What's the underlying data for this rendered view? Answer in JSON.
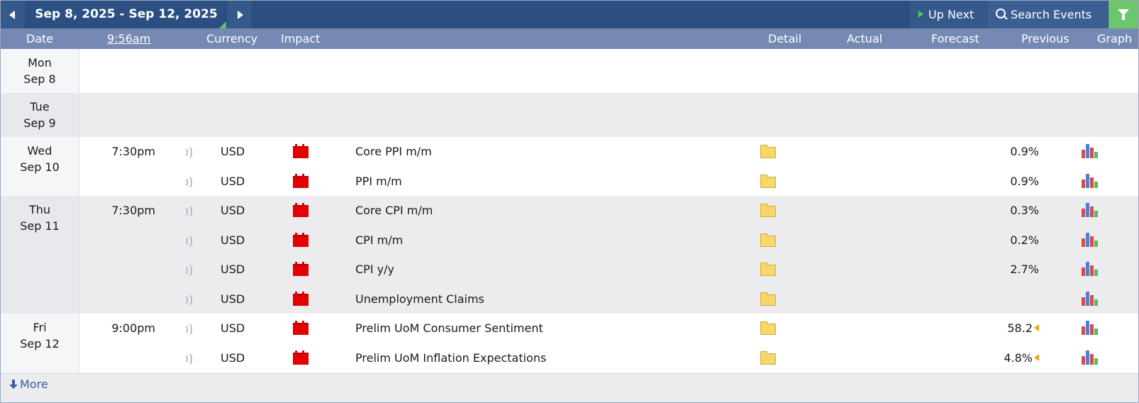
{
  "toolbar": {
    "date_range": "Sep 8, 2025 - Sep 12, 2025",
    "up_next": "Up Next",
    "search": "Search Events"
  },
  "columns": {
    "date": "Date",
    "time": "9:56am",
    "currency": "Currency",
    "impact": "Impact",
    "detail": "Detail",
    "actual": "Actual",
    "forecast": "Forecast",
    "previous": "Previous",
    "graph": "Graph"
  },
  "colors": {
    "header_bar": "#2c4f82",
    "column_bar": "#7589b3",
    "high_impact": "#e30000",
    "filter": "#6cc76c"
  },
  "icons": {
    "impact": "red-folder-high-impact-icon",
    "detail": "folder-icon",
    "graph": "bar-graph-icon",
    "sound": "sound-icon",
    "revised": "revised-arrow-icon"
  },
  "days": [
    {
      "name": "Mon",
      "date": "Sep 8",
      "events": []
    },
    {
      "name": "Tue",
      "date": "Sep 9",
      "events": []
    },
    {
      "name": "Wed",
      "date": "Sep 10",
      "events": [
        {
          "time": "7:30pm",
          "currency": "USD",
          "event": "Core PPI m/m",
          "actual": "",
          "forecast": "",
          "previous": "0.9%"
        },
        {
          "time": "",
          "currency": "USD",
          "event": "PPI m/m",
          "actual": "",
          "forecast": "",
          "previous": "0.9%"
        }
      ]
    },
    {
      "name": "Thu",
      "date": "Sep 11",
      "events": [
        {
          "time": "7:30pm",
          "currency": "USD",
          "event": "Core CPI m/m",
          "actual": "",
          "forecast": "",
          "previous": "0.3%"
        },
        {
          "time": "",
          "currency": "USD",
          "event": "CPI m/m",
          "actual": "",
          "forecast": "",
          "previous": "0.2%"
        },
        {
          "time": "",
          "currency": "USD",
          "event": "CPI y/y",
          "actual": "",
          "forecast": "",
          "previous": "2.7%"
        },
        {
          "time": "",
          "currency": "USD",
          "event": "Unemployment Claims",
          "actual": "",
          "forecast": "",
          "previous": ""
        }
      ]
    },
    {
      "name": "Fri",
      "date": "Sep 12",
      "events": [
        {
          "time": "9:00pm",
          "currency": "USD",
          "event": "Prelim UoM Consumer Sentiment",
          "actual": "",
          "forecast": "",
          "previous": "58.2",
          "revised": true
        },
        {
          "time": "",
          "currency": "USD",
          "event": "Prelim UoM Inflation Expectations",
          "actual": "",
          "forecast": "",
          "previous": "4.8%",
          "revised": true
        }
      ]
    }
  ],
  "footer": {
    "more": "More"
  }
}
